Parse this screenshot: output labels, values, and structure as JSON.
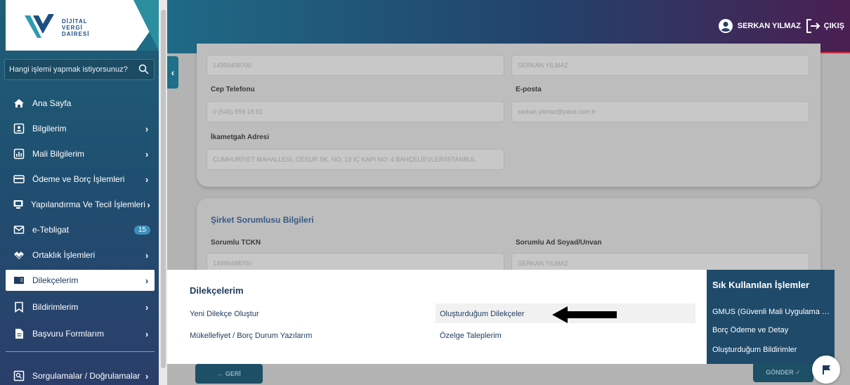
{
  "logo": {
    "line1": "DİJİTAL",
    "line2": "VERGİ",
    "line3": "DAİRESİ"
  },
  "search": {
    "placeholder": "Hangi işlemi yapmak istiyorsunuz?"
  },
  "sidebar": {
    "items": [
      {
        "label": "Ana Sayfa",
        "icon": "home-icon"
      },
      {
        "label": "Bilgilerim",
        "icon": "id-card-icon"
      },
      {
        "label": "Mali Bilgilerim",
        "icon": "bar-chart-icon"
      },
      {
        "label": "Ödeme ve Borç İşlemleri",
        "icon": "credit-card-icon"
      },
      {
        "label": "Yapılandırma Ve Tecil İşlemleri",
        "icon": "monitor-icon"
      },
      {
        "label": "e-Tebligat",
        "icon": "mail-icon",
        "badge": "15"
      },
      {
        "label": "Ortaklık İşlemleri",
        "icon": "handshake-icon"
      },
      {
        "label": "Dilekçelerim",
        "icon": "book-icon",
        "active": true
      },
      {
        "label": "Bildirimlerim",
        "icon": "bookmark-icon"
      },
      {
        "label": "Başvuru Formlarım",
        "icon": "document-icon"
      },
      {
        "label": "Sorgulamalar / Doğrulamalar",
        "icon": "search-doc-icon"
      }
    ]
  },
  "header": {
    "user_name": "SERKAN YILMAZ",
    "logout_label": "ÇIKIŞ"
  },
  "form": {
    "row1_left_value": "14999498700",
    "row1_right_value": "SERKAN YILMAZ",
    "phone_label": "Cep Telefonu",
    "phone_value": "0 (546) 859 18 81",
    "email_label": "E-posta",
    "email_value": "serkan.yilmaz@pavo.com.tr",
    "address_label": "İkametgah Adresi",
    "address_value": "CUMHURİYET MAHALLESİ, CESUR SK. NO: 13 İÇ KAPI NO: 4 BAHÇELİEVLER/İSTANBUL",
    "section2_title": "Şirket Sorumlusu Bilgileri",
    "tckn_label": "Sorumlu TCKN",
    "tckn_value": "14999498700",
    "name_label": "Sorumlu Ad Soyad/Unvan",
    "name_value": "SERKAN YILMAZ"
  },
  "buttons": {
    "back_label": "←  GERİ",
    "send_label": "GÖNDER  ✓"
  },
  "mega_menu": {
    "title": "Dilekçelerim",
    "links": [
      "Yeni Dilekçe Oluştur",
      "Oluşturduğum Dilekçeler",
      "Mükellefiyet / Borç Durum Yazılarım",
      "Özelge Taleplerim"
    ]
  },
  "quick_panel": {
    "title": "Sık Kullanılan İşlemler",
    "items": [
      "GMUS (Güvenli Mali Uygulama Sistemi)",
      "Borç Ödeme ve Detay",
      "Oluşturduğum Bildirimler"
    ]
  },
  "colors": {
    "sidebar": "#1f4f70",
    "header_accent": "#d32f3f",
    "brand_blue": "#1e3a5f"
  }
}
